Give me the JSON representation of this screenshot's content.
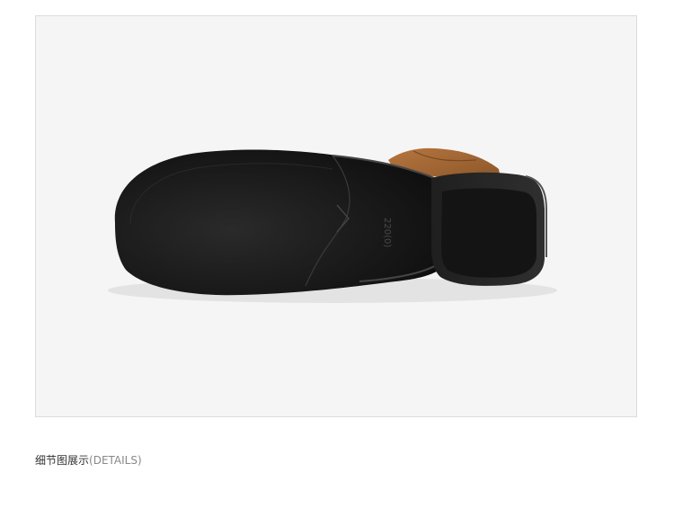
{
  "product_image": {
    "icon": "shoe-sole-photo",
    "sole_stamp": "220(0)",
    "colors": {
      "sole": "#1a1a1a",
      "suede": "#a0663a",
      "background": "#f5f5f5",
      "frame": "#dcdcdc"
    }
  },
  "caption": {
    "title": "细节图展示",
    "subtitle": "(DETAILS)"
  }
}
